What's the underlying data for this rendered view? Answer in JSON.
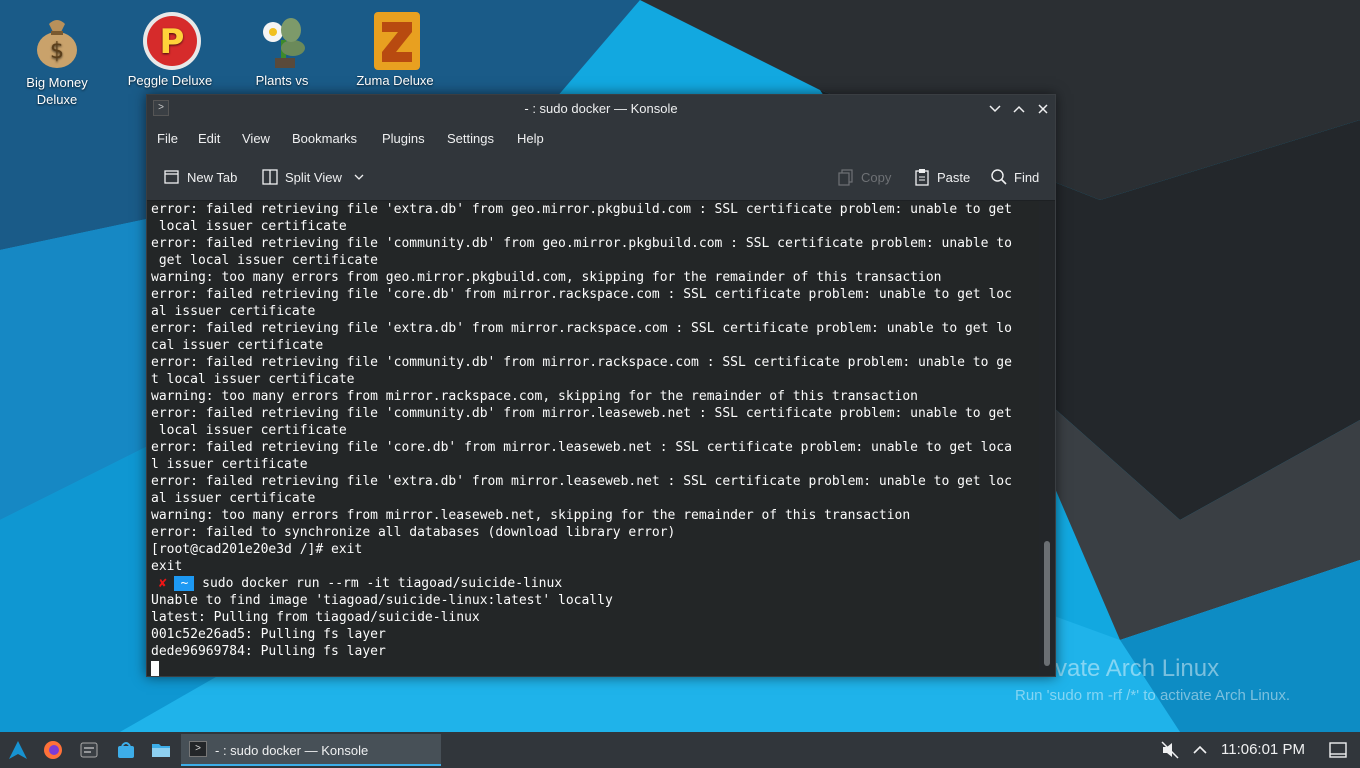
{
  "desktop": {
    "icons": [
      {
        "label_1": "Big Money",
        "label_2": "Deluxe",
        "icon": "money-bag-icon"
      },
      {
        "label_1": "Peggle Deluxe",
        "label_2": "",
        "icon": "peggle-icon"
      },
      {
        "label_1": "Plants vs",
        "label_2": "",
        "icon": "plants-vs-zombies-icon"
      },
      {
        "label_1": "Zuma Deluxe",
        "label_2": "",
        "icon": "zuma-icon"
      }
    ],
    "watermark": {
      "title": "Activate Arch Linux",
      "subtitle": "Run 'sudo rm -rf /*' to activate Arch Linux."
    }
  },
  "window": {
    "title": "- : sudo docker — Konsole",
    "menu": [
      "File",
      "Edit",
      "View",
      "Bookmarks",
      "Plugins",
      "Settings",
      "Help"
    ],
    "toolbar": {
      "new_tab": "New Tab",
      "split_view": "Split View",
      "copy": "Copy",
      "paste": "Paste",
      "find": "Find"
    },
    "terminal": {
      "lines": [
        "error: failed retrieving file 'extra.db' from geo.mirror.pkgbuild.com : SSL certificate problem: unable to get",
        " local issuer certificate",
        "error: failed retrieving file 'community.db' from geo.mirror.pkgbuild.com : SSL certificate problem: unable to",
        " get local issuer certificate",
        "warning: too many errors from geo.mirror.pkgbuild.com, skipping for the remainder of this transaction",
        "error: failed retrieving file 'core.db' from mirror.rackspace.com : SSL certificate problem: unable to get loc",
        "al issuer certificate",
        "error: failed retrieving file 'extra.db' from mirror.rackspace.com : SSL certificate problem: unable to get lo",
        "cal issuer certificate",
        "error: failed retrieving file 'community.db' from mirror.rackspace.com : SSL certificate problem: unable to ge",
        "t local issuer certificate",
        "warning: too many errors from mirror.rackspace.com, skipping for the remainder of this transaction",
        "error: failed retrieving file 'community.db' from mirror.leaseweb.net : SSL certificate problem: unable to get",
        " local issuer certificate",
        "error: failed retrieving file 'core.db' from mirror.leaseweb.net : SSL certificate problem: unable to get loca",
        "l issuer certificate",
        "error: failed retrieving file 'extra.db' from mirror.leaseweb.net : SSL certificate problem: unable to get loc",
        "al issuer certificate",
        "warning: too many errors from mirror.leaseweb.net, skipping for the remainder of this transaction",
        "error: failed to synchronize all databases (download library error)",
        "[root@cad201e20e3d /]# exit",
        "exit"
      ],
      "prompt": {
        "status": "✘",
        "dir": "~",
        "command": "sudo docker run --rm -it tiagoad/suicide-linux"
      },
      "after_lines": [
        "Unable to find image 'tiagoad/suicide-linux:latest' locally",
        "latest: Pulling from tiagoad/suicide-linux",
        "001c52e26ad5: Pulling fs layer",
        "dede96969784: Pulling fs layer"
      ]
    }
  },
  "taskbar": {
    "task_label": "- : sudo docker — Konsole",
    "clock": "11:06:01 PM"
  },
  "colors": {
    "desktop_blue": "#12a8e0",
    "window_bg": "#31363b",
    "terminal_bg": "#232627",
    "accent": "#3daee9",
    "prompt_error": "#ed1515",
    "prompt_dir_bg": "#1d99f3"
  }
}
